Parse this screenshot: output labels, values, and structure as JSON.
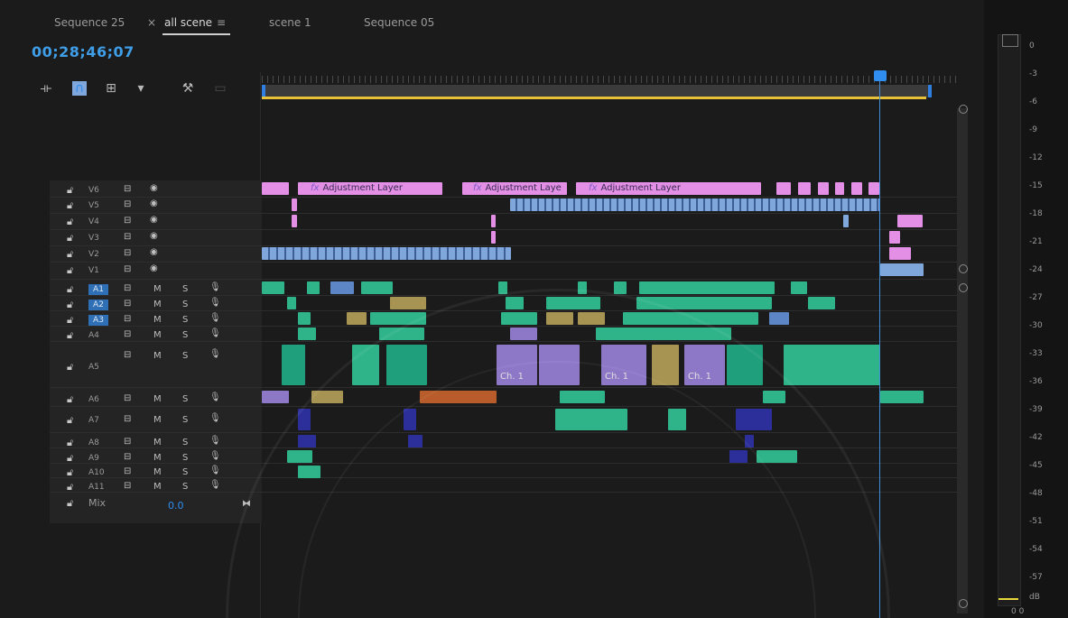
{
  "tabs": [
    {
      "label": "Sequence 25"
    },
    {
      "label": "all scene",
      "active": true
    },
    {
      "label": "scene 1"
    },
    {
      "label": "Sequence 05"
    }
  ],
  "tab_close_glyph": "×",
  "tab_menu_glyph": "≡",
  "timecode": "00;28;46;07",
  "tools": [
    {
      "icon": "snap-insert-icon"
    },
    {
      "icon": "magnet-icon"
    },
    {
      "icon": "linked-selection-icon"
    },
    {
      "icon": "marker-icon"
    },
    {
      "icon": "wrench-icon"
    },
    {
      "icon": "captions-icon"
    }
  ],
  "video_tracks": [
    "V6",
    "V5",
    "V4",
    "V3",
    "V2",
    "V1"
  ],
  "audio_tracks": [
    "A1",
    "A2",
    "A3",
    "A4",
    "A5",
    "A6",
    "A7",
    "A8",
    "A9",
    "A10",
    "A11"
  ],
  "selected_tracks": [
    "A1",
    "A2",
    "A3"
  ],
  "track_toggle_m": "M",
  "track_toggle_s": "S",
  "mix": {
    "label": "Mix",
    "value": "0.0"
  },
  "clip_labels": {
    "adjustment": [
      "Adjustment Layer",
      "Adjustment Laye",
      "Adjustment Layer"
    ],
    "ch1": [
      "Ch. 1",
      "Ch. 1",
      "Ch. 1"
    ],
    "fx": "fx"
  },
  "meter_labels": [
    "0",
    "-3",
    "-6",
    "-9",
    "-12",
    "-15",
    "-18",
    "-21",
    "-24",
    "-27",
    "-30",
    "-33",
    "-36",
    "-39",
    "-42",
    "-45",
    "-48",
    "-51",
    "-54",
    "-57",
    "dB"
  ],
  "meter_bottom": "0 0",
  "colors": {
    "timecode": "#3f9ee8",
    "playhead": "#2f8ef0",
    "adjustment_clip": "#e38fe6",
    "video_clip": "#7fa7db",
    "audio_clip": "#2fb48a",
    "selected_track": "#2f6fb5"
  }
}
